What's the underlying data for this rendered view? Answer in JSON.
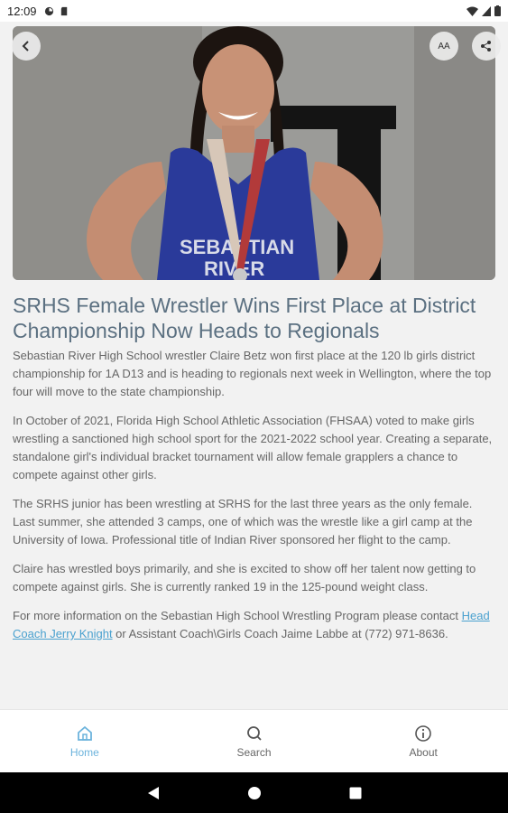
{
  "status_bar": {
    "time": "12:09"
  },
  "toolbar": {
    "text_size_label": "AA"
  },
  "article": {
    "title": "SRHS Female Wrestler Wins First Place at District Championship Now Heads to Regionals",
    "paragraphs": [
      "Sebastian River High School wrestler Claire Betz won first place at the 120 lb girls district championship for 1A D13 and is heading to regionals next week in Wellington, where the top four will move to the state championship.",
      "In October of 2021, Florida High School Athletic Association (FHSAA) voted to make girls wrestling a sanctioned high school sport for the 2021-2022 school year. Creating a separate, standalone girl's individual bracket tournament will allow female grapplers a chance to compete against other girls.",
      "The SRHS junior has been wrestling at SRHS for the last three years as the only female. Last summer, she attended 3 camps, one of which was the wrestle like a girl camp at the University of Iowa. Professional title of Indian River sponsored her flight to the camp.",
      "Claire has wrestled boys primarily, and she is excited to show off her talent now getting to compete against girls. She is currently ranked 19 in the 125-pound weight class."
    ],
    "contact": {
      "before": "For more information on the Sebastian High School Wrestling Program please contact ",
      "link": "Head Coach Jerry Knight",
      "after": " or Assistant Coach\\Girls Coach Jaime Labbe at (772) 971-8636."
    }
  },
  "nav": {
    "items": [
      {
        "label": "Home",
        "icon": "home-icon",
        "active": true
      },
      {
        "label": "Search",
        "icon": "search-icon",
        "active": false
      },
      {
        "label": "About",
        "icon": "info-icon",
        "active": false
      }
    ]
  },
  "colors": {
    "accent": "#6bb3dc",
    "title": "#5b7081",
    "jersey": "#2a3a9a"
  }
}
